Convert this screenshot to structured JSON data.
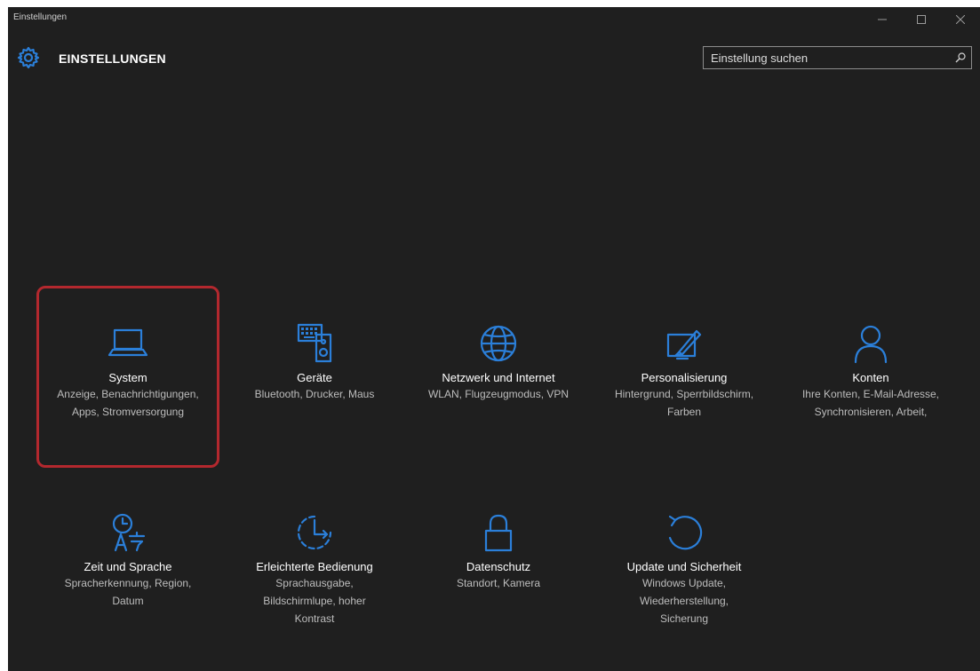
{
  "window": {
    "title": "Einstellungen"
  },
  "header": {
    "title": "EINSTELLUNGEN"
  },
  "search": {
    "placeholder": "Einstellung suchen"
  },
  "tiles": [
    {
      "name": "System",
      "desc": "Anzeige, Benachrichtigungen, Apps, Stromversorgung",
      "icon": "laptop-icon"
    },
    {
      "name": "Geräte",
      "desc": "Bluetooth, Drucker, Maus",
      "icon": "devices-icon"
    },
    {
      "name": "Netzwerk und Internet",
      "desc": "WLAN, Flugzeugmodus, VPN",
      "icon": "globe-icon"
    },
    {
      "name": "Personalisierung",
      "desc": "Hintergrund, Sperrbildschirm, Farben",
      "icon": "paint-icon"
    },
    {
      "name": "Konten",
      "desc": "Ihre Konten, E-Mail-Adresse, Synchronisieren, Arbeit,",
      "icon": "person-icon"
    },
    {
      "name": "Zeit und Sprache",
      "desc": "Spracherkennung, Region, Datum",
      "icon": "time-language-icon"
    },
    {
      "name": "Erleichterte Bedienung",
      "desc": "Sprachausgabe, Bildschirmlupe, hoher Kontrast",
      "icon": "accessibility-icon"
    },
    {
      "name": "Datenschutz",
      "desc": "Standort, Kamera",
      "icon": "lock-icon"
    },
    {
      "name": "Update und Sicherheit",
      "desc": "Windows Update, Wiederherstellung, Sicherung",
      "icon": "update-icon"
    }
  ],
  "colors": {
    "background": "#1f1f1f",
    "accent": "#2b7fd9",
    "highlight": "#b3282e"
  }
}
